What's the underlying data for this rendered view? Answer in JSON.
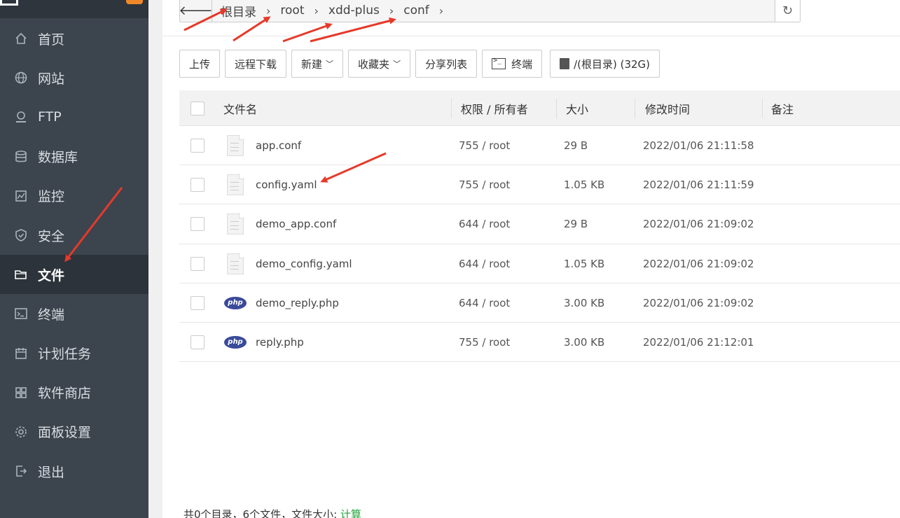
{
  "colors": {
    "sidebar_bg": "#3c444d",
    "sidebar_active_bg": "#2c333a",
    "accent_green": "#20a53a",
    "annotation_red": "#e53a2a",
    "logo_badge": "#f0882a"
  },
  "sidebar": {
    "items": [
      {
        "label": "首页",
        "icon": "home-icon"
      },
      {
        "label": "网站",
        "icon": "globe-icon"
      },
      {
        "label": "FTP",
        "icon": "ftp-icon"
      },
      {
        "label": "数据库",
        "icon": "database-icon"
      },
      {
        "label": "监控",
        "icon": "monitor-icon"
      },
      {
        "label": "安全",
        "icon": "shield-icon"
      },
      {
        "label": "文件",
        "icon": "folder-icon",
        "active": true
      },
      {
        "label": "终端",
        "icon": "terminal-icon"
      },
      {
        "label": "计划任务",
        "icon": "calendar-icon"
      },
      {
        "label": "软件商店",
        "icon": "apps-icon"
      },
      {
        "label": "面板设置",
        "icon": "gear-icon"
      },
      {
        "label": "退出",
        "icon": "logout-icon"
      }
    ]
  },
  "pathbar": {
    "back_icon": "🡐",
    "refresh_icon": "↻",
    "crumbs": [
      "根目录",
      "root",
      "xdd-plus",
      "conf"
    ]
  },
  "toolbar": {
    "upload": "上传",
    "remote_download": "远程下载",
    "new": "新建",
    "favorites": "收藏夹",
    "share_list": "分享列表",
    "terminal": "终端",
    "disk": "/(根目录) (32G)"
  },
  "table": {
    "headers": {
      "name": "文件名",
      "perm": "权限 / 所有者",
      "size": "大小",
      "mtime": "修改时间",
      "note": "备注"
    },
    "rows": [
      {
        "name": "app.conf",
        "perm": "755 / root",
        "size": "29 B",
        "mtime": "2022/01/06 21:11:58",
        "type": "file"
      },
      {
        "name": "config.yaml",
        "perm": "755 / root",
        "size": "1.05 KB",
        "mtime": "2022/01/06 21:11:59",
        "type": "file"
      },
      {
        "name": "demo_app.conf",
        "perm": "644 / root",
        "size": "29 B",
        "mtime": "2022/01/06 21:09:02",
        "type": "file"
      },
      {
        "name": "demo_config.yaml",
        "perm": "644 / root",
        "size": "1.05 KB",
        "mtime": "2022/01/06 21:09:02",
        "type": "file"
      },
      {
        "name": "demo_reply.php",
        "perm": "644 / root",
        "size": "3.00 KB",
        "mtime": "2022/01/06 21:09:02",
        "type": "php"
      },
      {
        "name": "reply.php",
        "perm": "755 / root",
        "size": "3.00 KB",
        "mtime": "2022/01/06 21:12:01",
        "type": "php"
      }
    ],
    "php_label": "php"
  },
  "footer": {
    "summary": "共0个目录，6个文件，文件大小: ",
    "compute_link": "计算"
  }
}
